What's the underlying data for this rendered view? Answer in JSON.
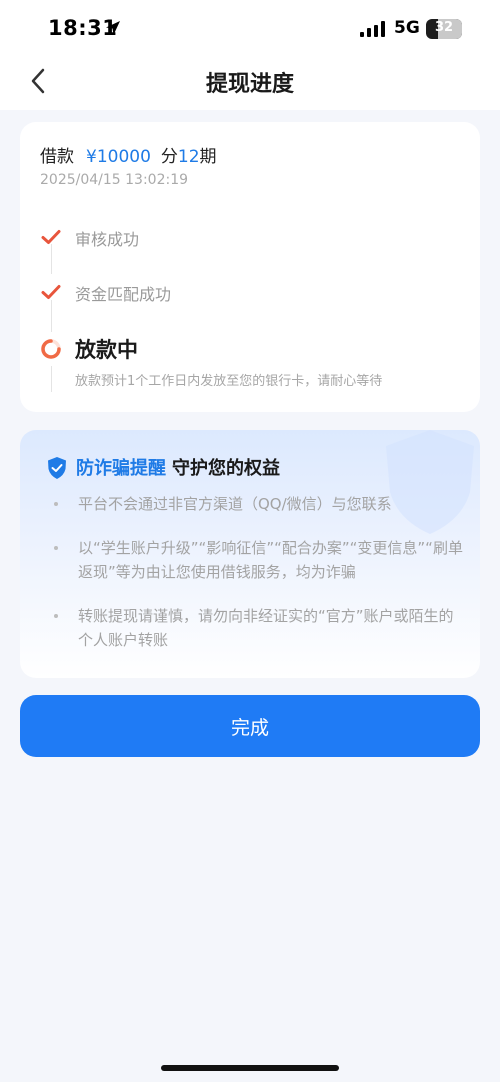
{
  "status_bar": {
    "time": "18:31",
    "network": "5G",
    "battery_level": "32",
    "battery_percent": 32
  },
  "header": {
    "title": "提现进度"
  },
  "loan": {
    "label": "借款",
    "amount": "¥10000",
    "period_prefix": "分",
    "period_count": "12",
    "period_suffix": "期",
    "datetime": "2025/04/15 13:02:19"
  },
  "steps": [
    {
      "label": "审核成功",
      "status": "done"
    },
    {
      "label": "资金匹配成功",
      "status": "done"
    },
    {
      "label": "放款中",
      "status": "in-progress",
      "desc": "放款预计1个工作日内发放至您的银行卡，请耐心等待"
    }
  ],
  "notice": {
    "title_highlight": "防诈骗提醒",
    "title_rest": "守护您的权益",
    "items": [
      "平台不会通过非官方渠道（QQ/微信）与您联系",
      "以“学生账户升级”“影响征信”“配合办案”“变更信息”“刷单返现”等为由让您使用借钱服务，均为诈骗",
      "转账提现请谨慎，请勿向非经证实的“官方”账户或陌生的个人账户转账"
    ]
  },
  "actions": {
    "done_label": "完成"
  },
  "colors": {
    "accent": "#1f7be6",
    "button": "#1f7bf5",
    "check": "#e8553c",
    "background": "#f4f6fb"
  },
  "icons": {
    "back": "chevron-left-icon",
    "location": "location-arrow-icon",
    "signal": "signal-icon",
    "check": "check-icon",
    "progress": "progress-ring-icon",
    "shield": "shield-icon"
  }
}
